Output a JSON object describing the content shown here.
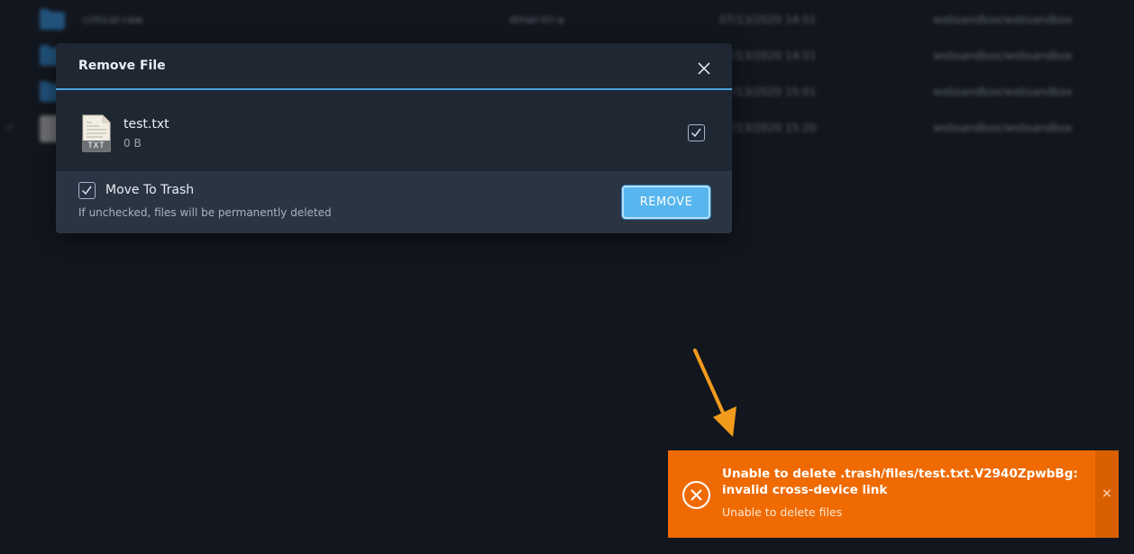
{
  "background_list": {
    "rows": [
      {
        "kind": "folder",
        "name": "critical-raw",
        "owner": "dinwi-tri-a",
        "date": "07/13/2020 14:51",
        "group": "websandbox/websandbox"
      },
      {
        "kind": "folder",
        "name": "",
        "owner": "",
        "date": "07/13/2020 14:51",
        "group": "websandbox/websandbox"
      },
      {
        "kind": "folder",
        "name": "",
        "owner": "",
        "date": "07/13/2020 15:01",
        "group": "websandbox/websandbox"
      },
      {
        "kind": "file",
        "name": "",
        "owner": "",
        "date": "07/13/2020 15:20",
        "group": "websandbox/websandbox"
      }
    ]
  },
  "modal": {
    "title": "Remove File",
    "file": {
      "name": "test.txt",
      "size": "0 B",
      "icon_label": "TXT",
      "checked": true
    },
    "move_to_trash": {
      "label": "Move To Trash",
      "hint": "If unchecked, files will be permanently deleted",
      "checked": true
    },
    "remove_label": "REMOVE"
  },
  "toast": {
    "title": "Unable to delete .trash/files/test.txt.V2940ZpwbBg: invalid cross-device link",
    "message": "Unable to delete files",
    "close_glyph": "×"
  },
  "colors": {
    "accent": "#58b6ee",
    "toast": "#ef6a00",
    "arrow": "#f29a1c"
  }
}
